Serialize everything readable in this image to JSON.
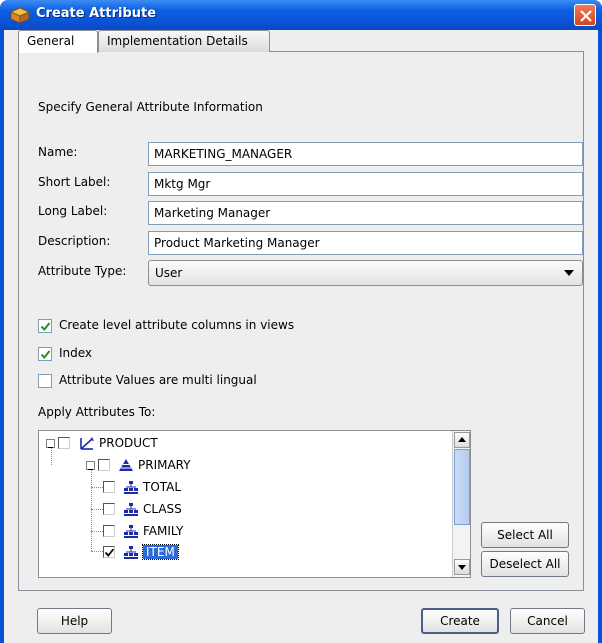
{
  "window": {
    "title": "Create Attribute"
  },
  "tabs": [
    {
      "label": "General",
      "active": true
    },
    {
      "label": "Implementation Details",
      "active": false
    }
  ],
  "heading": "Specify General Attribute Information",
  "fields": {
    "name": {
      "label": "Name:",
      "value": "MARKETING_MANAGER"
    },
    "short_label": {
      "label": "Short Label:",
      "value": "Mktg Mgr"
    },
    "long_label": {
      "label": "Long Label:",
      "value": "Marketing Manager"
    },
    "description": {
      "label": "Description:",
      "value": "Product Marketing Manager"
    },
    "attribute_type": {
      "label": "Attribute Type:",
      "value": "User"
    }
  },
  "checkboxes": [
    {
      "label": "Create level attribute columns in views",
      "checked": true
    },
    {
      "label": "Index",
      "checked": true
    },
    {
      "label": "Attribute Values are multi lingual",
      "checked": false
    }
  ],
  "apply_label": "Apply Attributes To:",
  "tree": {
    "dimension": {
      "label": "PRODUCT",
      "checked": false
    },
    "hierarchy": {
      "label": "PRIMARY",
      "checked": false
    },
    "levels": [
      {
        "label": "TOTAL",
        "checked": false,
        "selected": false
      },
      {
        "label": "CLASS",
        "checked": false,
        "selected": false
      },
      {
        "label": "FAMILY",
        "checked": false,
        "selected": false
      },
      {
        "label": "ITEM",
        "checked": true,
        "selected": true
      }
    ]
  },
  "buttons": {
    "select_all": "Select All",
    "deselect_all": "Deselect All",
    "help": "Help",
    "create": "Create",
    "cancel": "Cancel"
  },
  "colors": {
    "title_bar": "#0a54d8",
    "selection": "#2b6bd9",
    "check": "#2e8b1e",
    "close_button": "#d4441b"
  },
  "icons": {
    "window": "cube-icon",
    "close": "close-icon",
    "dimension": "dimension-icon",
    "hierarchy": "hierarchy-icon",
    "level": "level-icon",
    "dropdown": "chevron-down-icon"
  }
}
